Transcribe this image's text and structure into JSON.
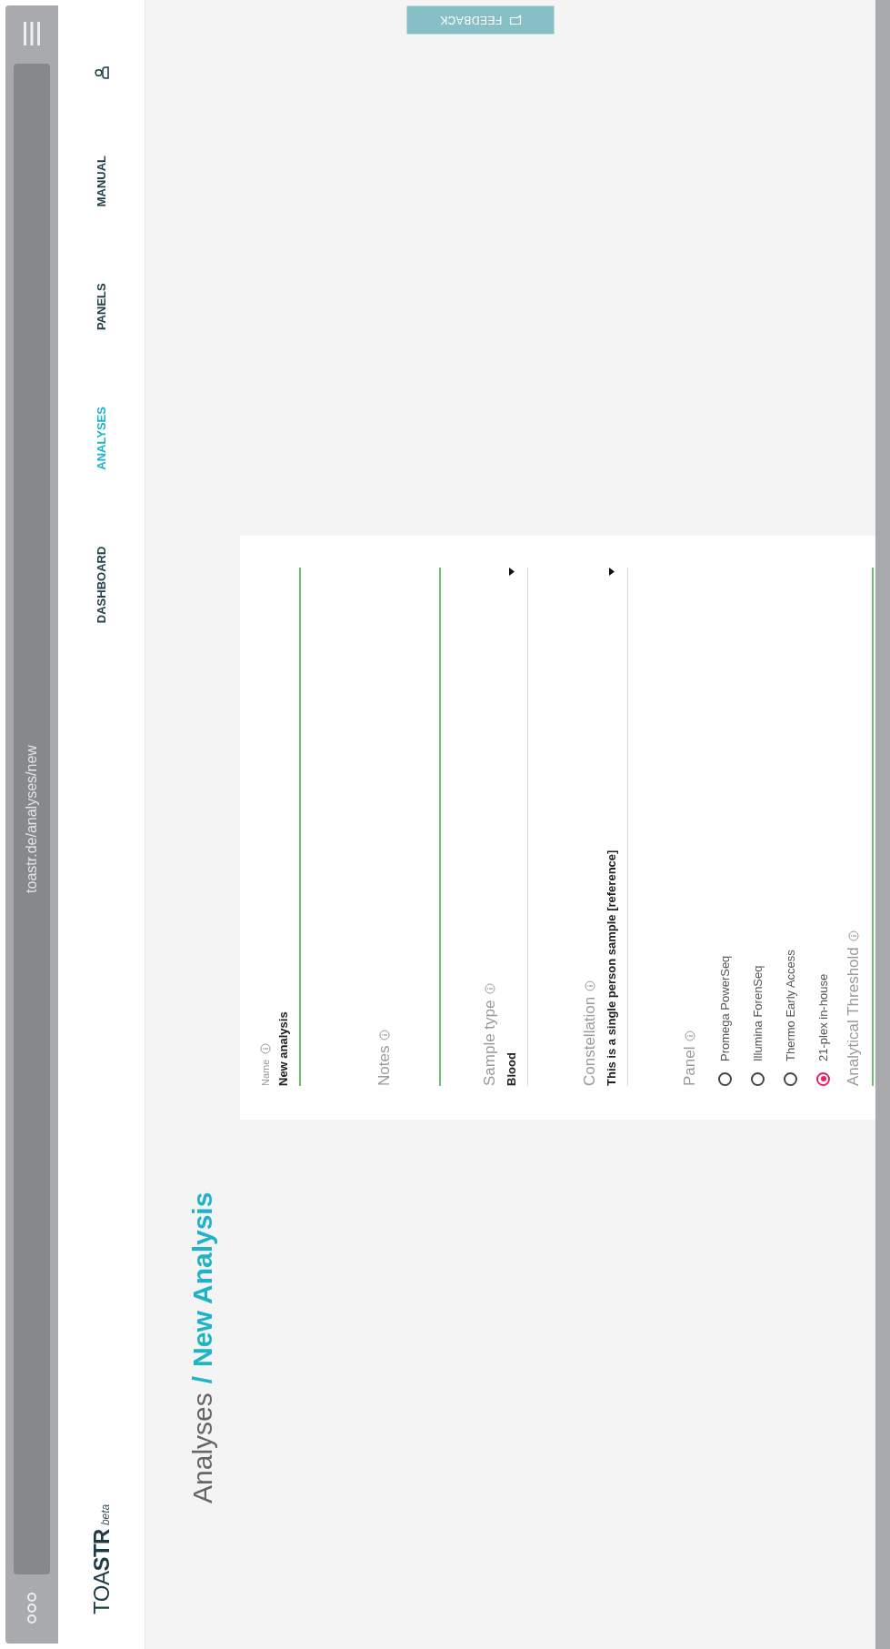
{
  "browser": {
    "url": "toastr.de/analyses/new"
  },
  "header": {
    "logo": "TOA**STR**",
    "badge": "beta",
    "nav": [
      {
        "label": "DASHBOARD",
        "selected": false
      },
      {
        "label": "ANALYSES",
        "selected": true
      },
      {
        "label": "PANELS",
        "selected": false
      },
      {
        "label": "MANUAL",
        "selected": false
      }
    ]
  },
  "breadcrumb": {
    "parent": "Analyses",
    "separator": "/",
    "current": "New Analysis"
  },
  "feedback": {
    "label": "FEEDBACK"
  },
  "form": {
    "fields": [
      {
        "kind": "text",
        "label": "Name",
        "value": "New analysis"
      },
      {
        "kind": "textarea",
        "label": "Notes"
      },
      {
        "kind": "select",
        "label": "Sample type",
        "value": "Blood"
      },
      {
        "kind": "select",
        "label": "Constellation",
        "value": "This is a single person sample [reference]"
      },
      {
        "kind": "radio",
        "label": "Panel",
        "options": [
          {
            "label": "Promega PowerSeq",
            "selected": false
          },
          {
            "label": "Illumina ForenSeq",
            "selected": false
          },
          {
            "label": "Thermo Early Access",
            "selected": false
          },
          {
            "label": "21-plex in-house",
            "selected": true
          }
        ]
      },
      {
        "kind": "text",
        "label": "Analytical Threshold"
      }
    ]
  }
}
